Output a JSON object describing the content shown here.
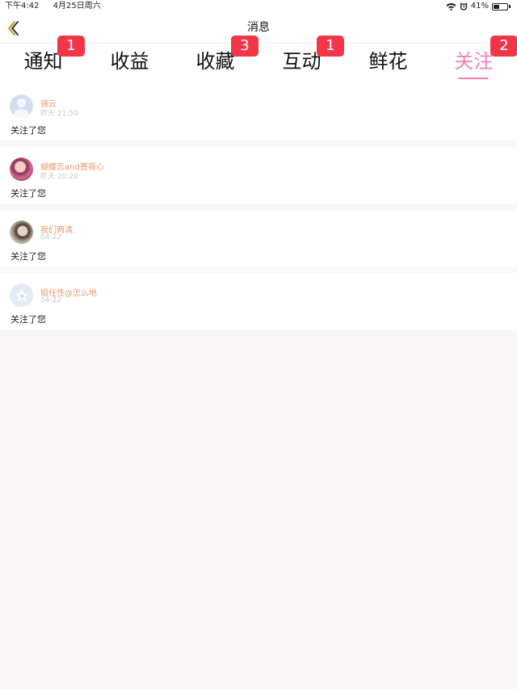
{
  "status_bar": {
    "time": "下午4:42",
    "date": "4月25日周六",
    "battery": "41%",
    "battery_level": 0.41,
    "wifi_icon": "wifi-icon",
    "alarm_icon": "alarm-clock-icon"
  },
  "nav": {
    "title": "消息",
    "back_icon": "chevron-left-icon"
  },
  "tabs": [
    {
      "label": "通知",
      "badge": "1",
      "active": false
    },
    {
      "label": "收益",
      "badge": "",
      "active": false
    },
    {
      "label": "收藏",
      "badge": "3",
      "active": false
    },
    {
      "label": "互动",
      "badge": "1",
      "active": false
    },
    {
      "label": "鲜花",
      "badge": "",
      "active": false
    },
    {
      "label": "关注",
      "badge": "2",
      "active": true
    }
  ],
  "colors": {
    "accent": "#f080b8",
    "badge": "#f2364a",
    "username": "#e89a6e"
  },
  "follows": [
    {
      "user": "镜云",
      "time": "昨天 21:50",
      "text": "关注了您",
      "avatar": "default-avatar-icon"
    },
    {
      "user": "蝴蝶恋and蔷薇心",
      "time": "昨天 20:20",
      "text": "关注了您",
      "avatar": "user-photo-avatar"
    },
    {
      "user": "我们两清.",
      "time": "04-22",
      "text": "关注了您",
      "avatar": "user-photo-avatar"
    },
    {
      "user": "姐任性@怎么地",
      "time": "04-22",
      "text": "关注了您",
      "avatar": "star-avatar-icon"
    }
  ]
}
